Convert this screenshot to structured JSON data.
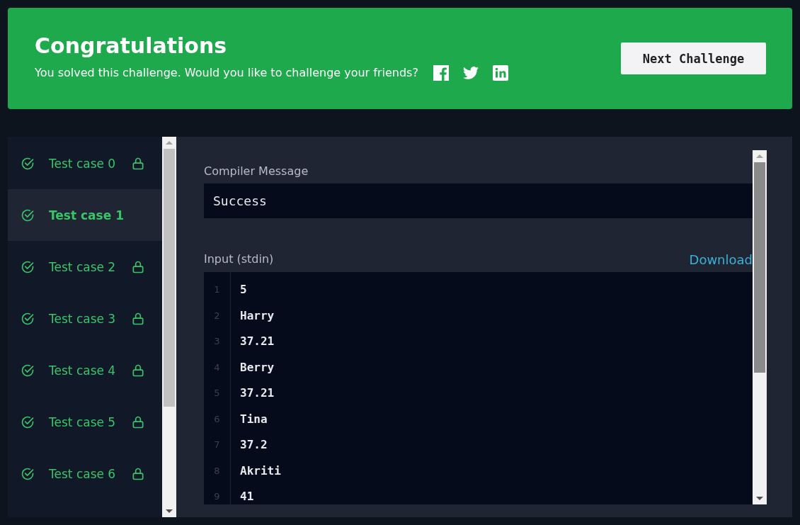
{
  "banner": {
    "title": "Congratulations",
    "message": "You solved this challenge. Would you like to challenge your friends?",
    "share_icons": [
      {
        "kind": "facebook"
      },
      {
        "kind": "twitter"
      },
      {
        "kind": "linkedin"
      }
    ],
    "button": "Next Challenge"
  },
  "test_cases": [
    {
      "label": "Test case 0",
      "passed": true,
      "locked": true,
      "selected": false
    },
    {
      "label": "Test case 1",
      "passed": true,
      "locked": false,
      "selected": true
    },
    {
      "label": "Test case 2",
      "passed": true,
      "locked": true,
      "selected": false
    },
    {
      "label": "Test case 3",
      "passed": true,
      "locked": true,
      "selected": false
    },
    {
      "label": "Test case 4",
      "passed": true,
      "locked": true,
      "selected": false
    },
    {
      "label": "Test case 5",
      "passed": true,
      "locked": true,
      "selected": false
    },
    {
      "label": "Test case 6",
      "passed": true,
      "locked": true,
      "selected": false
    }
  ],
  "compiler_message": {
    "label": "Compiler Message",
    "value": "Success"
  },
  "input": {
    "label": "Input (stdin)",
    "link": "Download",
    "lines": [
      {
        "number": "1",
        "text": "5"
      },
      {
        "number": "2",
        "text": "Harry"
      },
      {
        "number": "3",
        "text": "37.21"
      },
      {
        "number": "4",
        "text": "Berry"
      },
      {
        "number": "5",
        "text": "37.21"
      },
      {
        "number": "6",
        "text": "Tina"
      },
      {
        "number": "7",
        "text": "37.2"
      },
      {
        "number": "8",
        "text": "Akriti"
      },
      {
        "number": "9",
        "text": "41"
      }
    ]
  }
}
